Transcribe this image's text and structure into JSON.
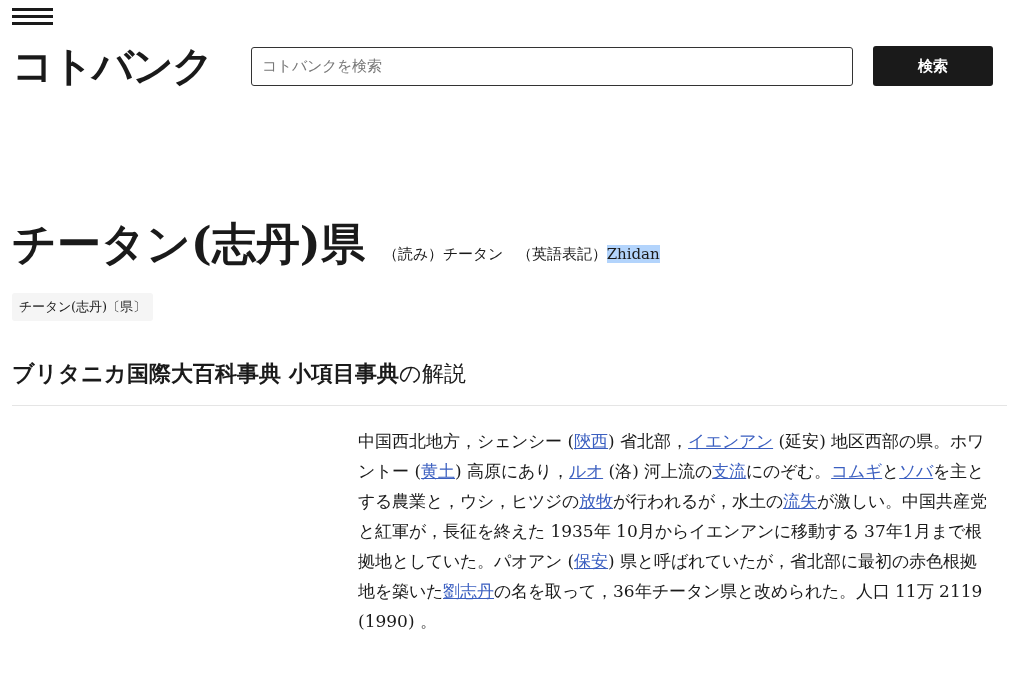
{
  "header": {
    "logo": "コトバンク",
    "search": {
      "placeholder": "コトバンクを検索"
    },
    "search_button": "検索"
  },
  "entry": {
    "title": "チータン(志丹)県",
    "reading_label": "（読み）",
    "reading": "チータン",
    "english_label": "（英語表記）",
    "english": "Zhidan",
    "english_selected": true,
    "tags": [
      "チータン(志丹)〔県〕"
    ]
  },
  "section": {
    "heading": "**ブリタニカ国際大百科事典 小項目事典**の解説",
    "body": [
      {
        "text": "中国西北地方，シェンシー (",
        "link": false
      },
      {
        "text": "陝西",
        "link": true
      },
      {
        "text": ") 省北部，",
        "link": false
      },
      {
        "text": "イエンアン",
        "link": true
      },
      {
        "text": " (延安) 地区西部の県。ホワントー (",
        "link": false
      },
      {
        "text": "黄土",
        "link": true
      },
      {
        "text": ") 高原にあり，",
        "link": false
      },
      {
        "text": "ルオ",
        "link": true
      },
      {
        "text": " (洛) 河上流の",
        "link": false
      },
      {
        "text": "支流",
        "link": true
      },
      {
        "text": "にのぞむ。",
        "link": false
      },
      {
        "text": "コムギ",
        "link": true
      },
      {
        "text": "と",
        "link": false
      },
      {
        "text": "ソバ",
        "link": true
      },
      {
        "text": "を主とする農業と，ウシ，ヒツジの",
        "link": false
      },
      {
        "text": "放牧",
        "link": true
      },
      {
        "text": "が行われるが，水土の",
        "link": false
      },
      {
        "text": "流失",
        "link": true
      },
      {
        "text": "が激しい。中国共産党と紅軍が，長征を終えた 1935年 10月からイエンアンに移動する 37年1月まで根拠地としていた。パオアン (",
        "link": false
      },
      {
        "text": "保安",
        "link": true
      },
      {
        "text": ") 県と呼ばれていたが，省北部に最初の赤色根拠地を築いた",
        "link": false
      },
      {
        "text": "劉志丹",
        "link": true
      },
      {
        "text": "の名を取って，36年チータン県と改められた。人口 11万 2119 (1990) 。",
        "link": false
      }
    ]
  }
}
